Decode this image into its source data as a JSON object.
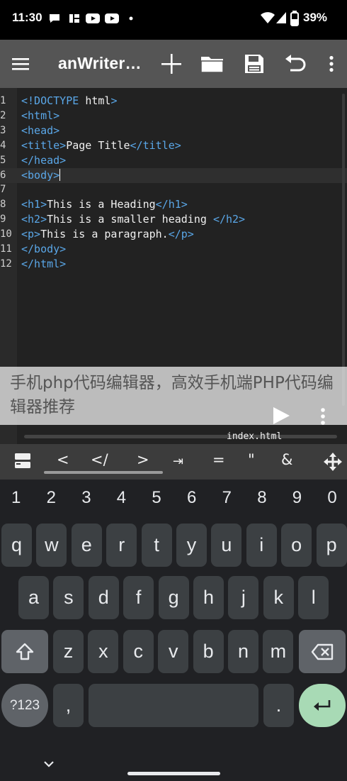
{
  "status_bar": {
    "time": "11:30",
    "battery": "39%"
  },
  "app_bar": {
    "title": "anWriter…"
  },
  "editor": {
    "lines": [
      {
        "n": "1",
        "parts": [
          [
            "tag",
            "<!DOCTYPE "
          ],
          [
            "txt",
            "html"
          ],
          [
            "tag",
            ">"
          ]
        ]
      },
      {
        "n": "2",
        "parts": [
          [
            "tag",
            "<html>"
          ]
        ]
      },
      {
        "n": "3",
        "parts": [
          [
            "tag",
            "<head>"
          ]
        ]
      },
      {
        "n": "4",
        "parts": [
          [
            "tag",
            "<title>"
          ],
          [
            "txt",
            "Page Title"
          ],
          [
            "tag",
            "</title>"
          ]
        ]
      },
      {
        "n": "5",
        "parts": [
          [
            "tag",
            "</head>"
          ]
        ]
      },
      {
        "n": "6",
        "parts": [
          [
            "tag",
            "<body>"
          ]
        ],
        "current": true
      },
      {
        "n": "7",
        "parts": []
      },
      {
        "n": "8",
        "parts": [
          [
            "tag",
            "<h1>"
          ],
          [
            "txt",
            "This is a Heading"
          ],
          [
            "tag",
            "</h1>"
          ]
        ]
      },
      {
        "n": "9",
        "parts": [
          [
            "tag",
            "<h2>"
          ],
          [
            "txt",
            "This is a smaller heading "
          ],
          [
            "tag",
            "</h2>"
          ]
        ]
      },
      {
        "n": "10",
        "parts": [
          [
            "tag",
            "<p>"
          ],
          [
            "txt",
            "This is a paragraph."
          ],
          [
            "tag",
            "</p>"
          ]
        ]
      },
      {
        "n": "11",
        "parts": [
          [
            "tag",
            "</body>"
          ]
        ]
      },
      {
        "n": "12",
        "parts": [
          [
            "tag",
            "</html>"
          ]
        ]
      }
    ],
    "filename": "index.html"
  },
  "overlay": {
    "text": "手机php代码编辑器，高效手机端PHP代码编辑器推荐"
  },
  "symbol_bar": {
    "keys": [
      "<",
      "</",
      ">",
      "⇥",
      "=",
      "\"",
      "&"
    ]
  },
  "keyboard": {
    "numbers": [
      "1",
      "2",
      "3",
      "4",
      "5",
      "6",
      "7",
      "8",
      "9",
      "0"
    ],
    "row1": [
      "q",
      "w",
      "e",
      "r",
      "t",
      "y",
      "u",
      "i",
      "o",
      "p"
    ],
    "row2": [
      "a",
      "s",
      "d",
      "f",
      "g",
      "h",
      "j",
      "k",
      "l"
    ],
    "row3": [
      "z",
      "x",
      "c",
      "v",
      "b",
      "n",
      "m"
    ],
    "symbols_key": "?123",
    "comma_key": ",",
    "period_key": "."
  },
  "colors": {
    "tag": "#5aa7e8",
    "appbar": "#555555",
    "enter": "#a8dab5"
  }
}
